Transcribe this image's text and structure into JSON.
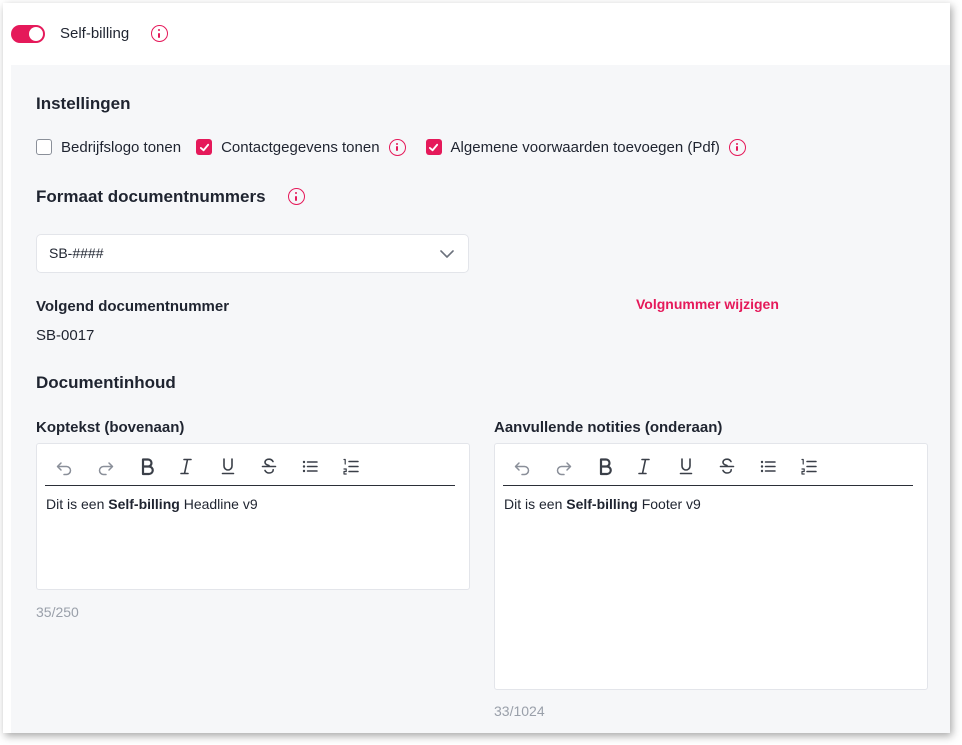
{
  "colors": {
    "accent": "#e5195a",
    "text": "#1f2430",
    "muted": "#9aa0aa",
    "icon_gray": "#8a8f99",
    "panel_bg": "#f6f7f9"
  },
  "header": {
    "toggle_on": true,
    "title": "Self-billing",
    "info_icon": "info-circle-icon"
  },
  "settings": {
    "heading": "Instellingen",
    "checkboxes": [
      {
        "label": "Bedrijfslogo tonen",
        "checked": false,
        "info": false
      },
      {
        "label": "Contactgegevens tonen",
        "checked": true,
        "info": true
      },
      {
        "label": "Algemene voorwaarden toevoegen (Pdf)",
        "checked": true,
        "info": true
      }
    ]
  },
  "format": {
    "heading": "Formaat documentnummers",
    "selected": "SB-####"
  },
  "next_number": {
    "label": "Volgend documentnummer",
    "value": "SB-0017",
    "change_link": "Volgnummer wijzigen"
  },
  "content": {
    "heading": "Documentinhoud",
    "header_editor": {
      "label": "Koptekst (bovenaan)",
      "text_before": "Dit is een ",
      "text_bold": "Self-billing",
      "text_after": " Headline v9",
      "counter": "35/250"
    },
    "footer_editor": {
      "label": "Aanvullende notities (onderaan)",
      "text_before": "Dit is een ",
      "text_bold": "Self-billing",
      "text_after": " Footer v9",
      "counter": "33/1024"
    },
    "toolbar_icons": [
      "undo-icon",
      "redo-icon",
      "bold-icon",
      "italic-icon",
      "underline-icon",
      "strikethrough-icon",
      "bullet-list-icon",
      "numbered-list-icon"
    ]
  }
}
